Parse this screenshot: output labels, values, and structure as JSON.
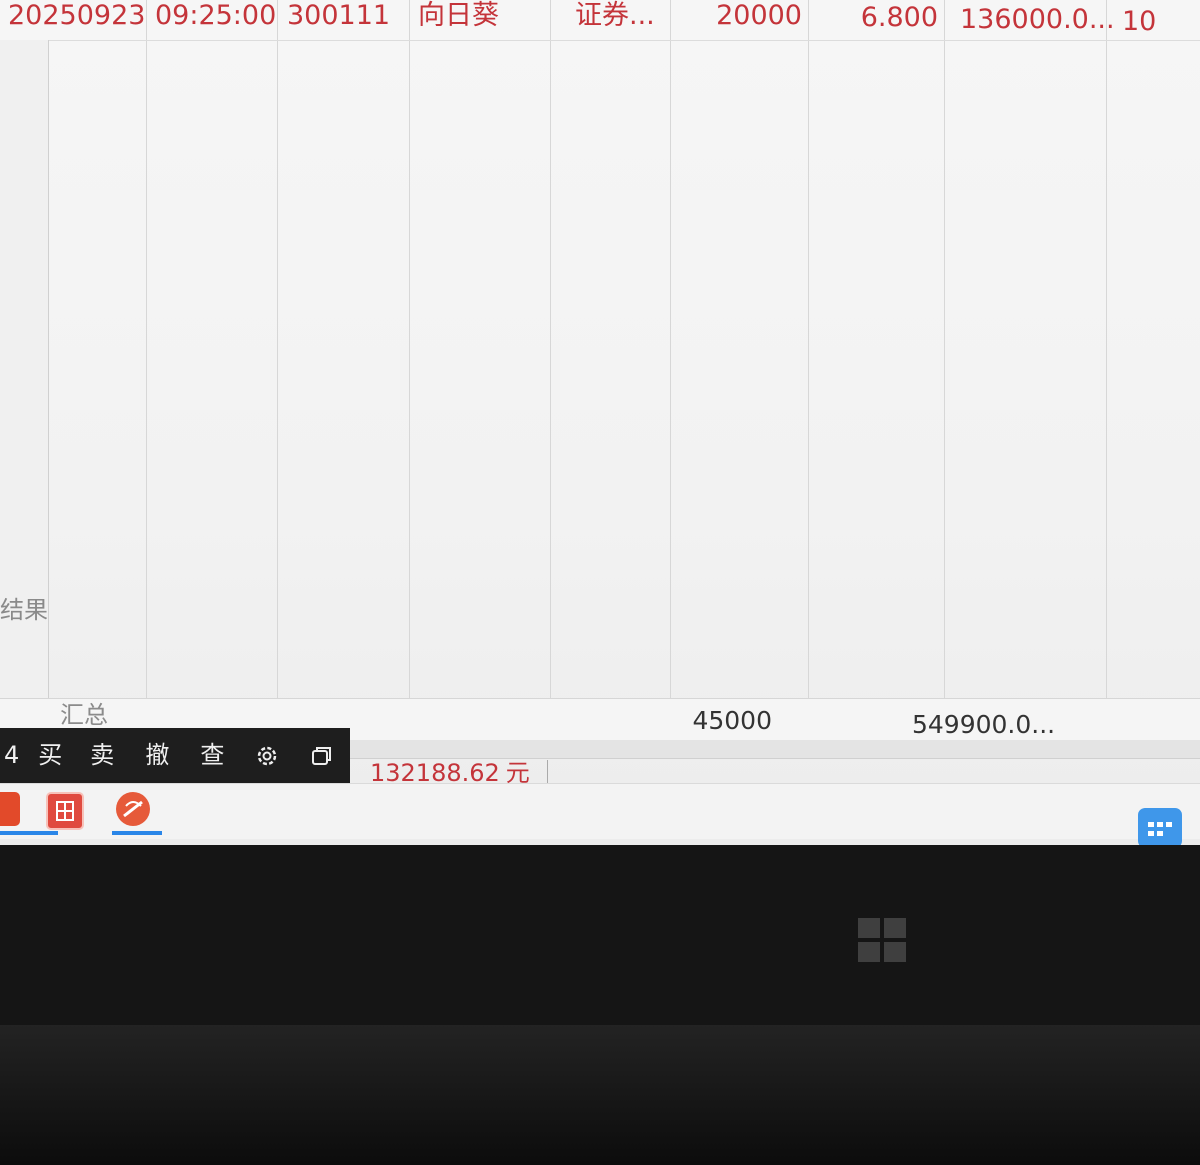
{
  "table": {
    "row": [
      "20250923",
      "09:25:00",
      "300111",
      "向日葵",
      "证券...",
      "20000",
      "6.800",
      "136000.0...",
      "10"
    ],
    "summary_label": "汇总",
    "summary_qty": "45000",
    "summary_amount": "549900.0..."
  },
  "side_label": "结果",
  "toolbar": {
    "num": "4",
    "buy": "买",
    "sell": "卖",
    "cancel": "撤",
    "query": "查",
    "settings_icon": "gear-icon",
    "window_icon": "restore-window-icon"
  },
  "status": {
    "balance": "132188.62",
    "unit": "元"
  },
  "colors": {
    "text_red": "#c4343a",
    "toolbar_bg": "#1e1e1e",
    "taskbar_accent": "#2a86e8"
  }
}
